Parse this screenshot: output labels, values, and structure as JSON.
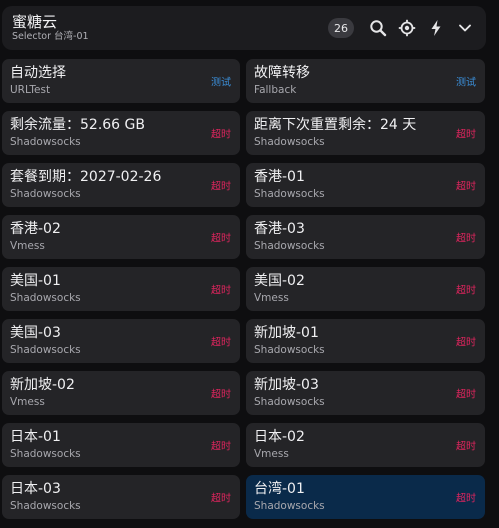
{
  "header": {
    "title": "蜜糖云",
    "subtitle": "Selector 台湾-01",
    "count": "26",
    "icons": [
      "search-icon",
      "locate-icon",
      "lightning-icon",
      "chevron-down-icon"
    ]
  },
  "colors": {
    "test_status": "#3b8fd9",
    "timeout_status": "#e0245e",
    "selected_card": "#0a2a4a",
    "card": "#242427"
  },
  "proxies": [
    {
      "name": "自动选择",
      "type": "URLTest",
      "status": "测试",
      "status_kind": "test"
    },
    {
      "name": "故障转移",
      "type": "Fallback",
      "status": "测试",
      "status_kind": "test"
    },
    {
      "name": "剩余流量：52.66 GB",
      "type": "Shadowsocks",
      "status": "超时",
      "status_kind": "timeout"
    },
    {
      "name": "距离下次重置剩余：24 天",
      "type": "Shadowsocks",
      "status": "超时",
      "status_kind": "timeout"
    },
    {
      "name": "套餐到期：2027-02-26",
      "type": "Shadowsocks",
      "status": "超时",
      "status_kind": "timeout"
    },
    {
      "name": "香港-01",
      "type": "Shadowsocks",
      "status": "超时",
      "status_kind": "timeout"
    },
    {
      "name": "香港-02",
      "type": "Vmess",
      "status": "超时",
      "status_kind": "timeout"
    },
    {
      "name": "香港-03",
      "type": "Shadowsocks",
      "status": "超时",
      "status_kind": "timeout"
    },
    {
      "name": "美国-01",
      "type": "Shadowsocks",
      "status": "超时",
      "status_kind": "timeout"
    },
    {
      "name": "美国-02",
      "type": "Vmess",
      "status": "超时",
      "status_kind": "timeout"
    },
    {
      "name": "美国-03",
      "type": "Shadowsocks",
      "status": "超时",
      "status_kind": "timeout"
    },
    {
      "name": "新加坡-01",
      "type": "Shadowsocks",
      "status": "超时",
      "status_kind": "timeout"
    },
    {
      "name": "新加坡-02",
      "type": "Vmess",
      "status": "超时",
      "status_kind": "timeout"
    },
    {
      "name": "新加坡-03",
      "type": "Shadowsocks",
      "status": "超时",
      "status_kind": "timeout"
    },
    {
      "name": "日本-01",
      "type": "Shadowsocks",
      "status": "超时",
      "status_kind": "timeout"
    },
    {
      "name": "日本-02",
      "type": "Vmess",
      "status": "超时",
      "status_kind": "timeout"
    },
    {
      "name": "日本-03",
      "type": "Shadowsocks",
      "status": "超时",
      "status_kind": "timeout"
    },
    {
      "name": "台湾-01",
      "type": "Shadowsocks",
      "status": "超时",
      "status_kind": "timeout",
      "selected": true
    }
  ]
}
